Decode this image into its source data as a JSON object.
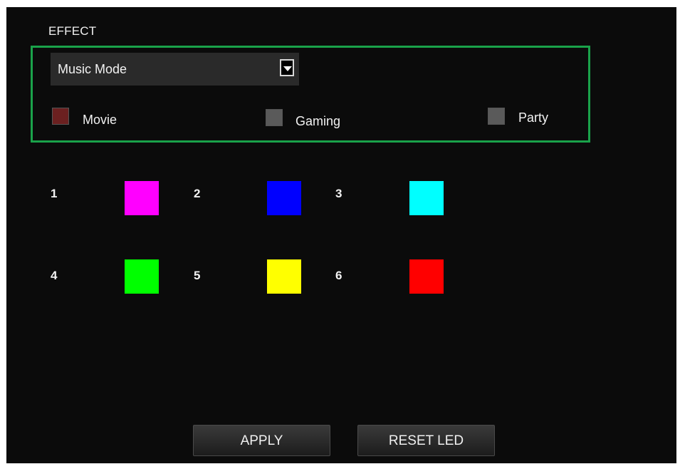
{
  "effect": {
    "label": "EFFECT",
    "select": {
      "value": "Music Mode"
    },
    "options": [
      {
        "label": "Movie",
        "color": "#6b2020",
        "checked": true
      },
      {
        "label": "Gaming",
        "color": "#5a5a5a",
        "checked": false
      },
      {
        "label": "Party",
        "color": "#5a5a5a",
        "checked": false
      }
    ]
  },
  "colors": [
    {
      "num": "1",
      "color": "#ff00ff"
    },
    {
      "num": "2",
      "color": "#0000ff"
    },
    {
      "num": "3",
      "color": "#00ffff"
    },
    {
      "num": "4",
      "color": "#00ff00"
    },
    {
      "num": "5",
      "color": "#ffff00"
    },
    {
      "num": "6",
      "color": "#ff0000"
    }
  ],
  "buttons": {
    "apply": "APPLY",
    "reset": "RESET LED"
  },
  "theme": {
    "accent_border": "#1aa24a"
  }
}
